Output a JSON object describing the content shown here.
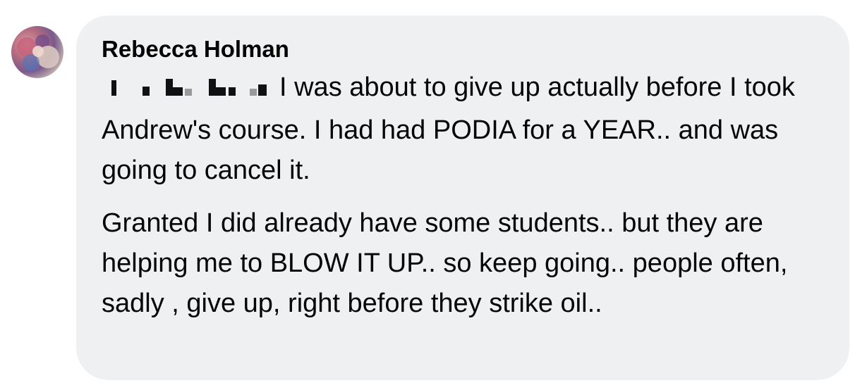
{
  "comment": {
    "author": "Rebecca Holman",
    "avatar_icon": "profile-photo",
    "paragraphs": [
      "I was about to give up actually before I took Andrew's course. I had had PODIA for a YEAR.. and was going to cancel it.",
      "Granted I did already have some students.. but they are helping me to BLOW IT UP.. so keep going.. people often, sadly , give up, right before they strike oil.."
    ],
    "redacted_mention": true
  },
  "colors": {
    "bubble": "#eff0f2",
    "text": "#050505",
    "background": "#ffffff"
  }
}
